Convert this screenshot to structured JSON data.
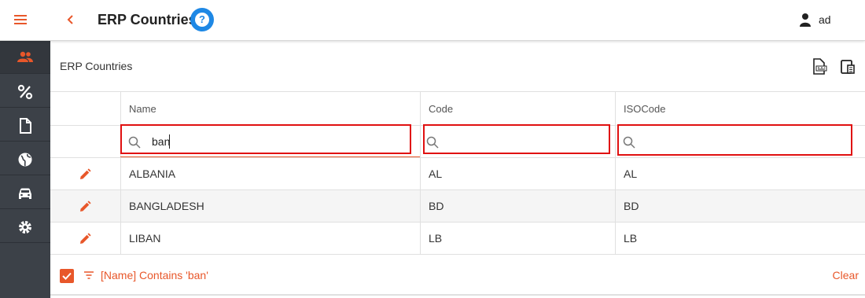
{
  "header": {
    "title": "ERP Countries",
    "help_label": "?",
    "user_name": "ad"
  },
  "sidebar": {
    "items": [
      {
        "icon": "people-icon",
        "active": true
      },
      {
        "icon": "percent-icon",
        "label": "%"
      },
      {
        "icon": "document-icon"
      },
      {
        "icon": "globe-icon"
      },
      {
        "icon": "car-icon"
      },
      {
        "icon": "gear-icon"
      }
    ]
  },
  "panel": {
    "title": "ERP Countries",
    "tools": [
      "export-icon",
      "column-chooser-icon"
    ]
  },
  "grid": {
    "columns": [
      "Name",
      "Code",
      "ISOCode"
    ],
    "filters": {
      "name": "ban",
      "code": "",
      "isocode": ""
    },
    "rows": [
      {
        "name": "ALBANIA",
        "code": "AL",
        "iso": "AL"
      },
      {
        "name": "BANGLADESH",
        "code": "BD",
        "iso": "BD"
      },
      {
        "name": "LIBAN",
        "code": "LB",
        "iso": "LB"
      }
    ]
  },
  "filter_bar": {
    "text": "[Name] Contains 'ban'",
    "clear_label": "Clear"
  },
  "colors": {
    "accent": "#e8572a",
    "sidebar": "#3c4148",
    "help": "#1e88e5",
    "highlight_box": "#e01010"
  }
}
